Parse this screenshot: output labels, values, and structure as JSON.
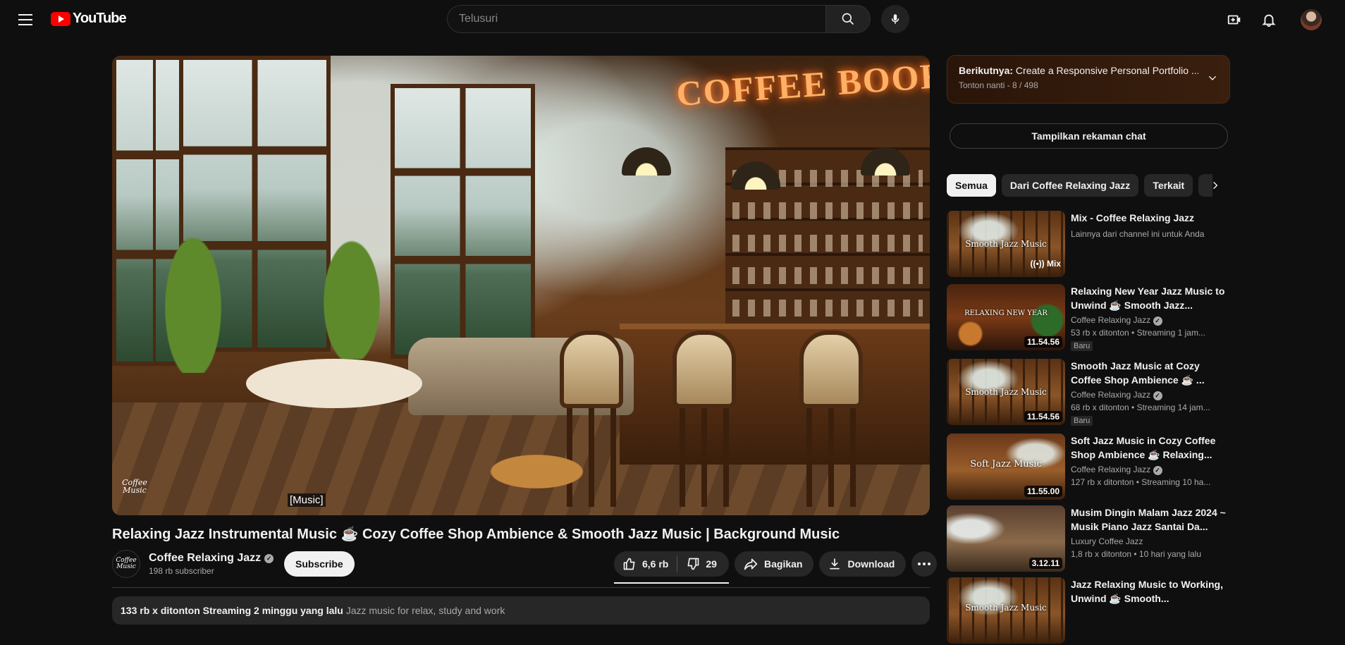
{
  "header": {
    "logo_text": "YouTube",
    "search_placeholder": "Telusuri"
  },
  "video": {
    "caption": "[Music]",
    "watermark": "Coffee Music",
    "scene_sign": "COFFEE BOOK SHOP",
    "title": "Relaxing Jazz Instrumental Music ☕ Cozy Coffee Shop Ambience & Smooth Jazz Music | Background Music"
  },
  "owner": {
    "name": "Coffee Relaxing Jazz",
    "subscribers": "198 rb subscriber",
    "avatar_text": "Coffee Music",
    "subscribe_label": "Subscribe"
  },
  "actions": {
    "likes": "6,6 rb",
    "dislikes": "29",
    "share_label": "Bagikan",
    "download_label": "Download"
  },
  "description": {
    "stats": "133 rb x ditonton  Streaming 2 minggu yang lalu",
    "snippet": "Jazz music for relax, study and work"
  },
  "playlist": {
    "next_prefix": "Berikutnya:",
    "next_title": "Create a Responsive Personal Portfolio ...",
    "position": "Tonton nanti - 8 / 498"
  },
  "chat_button_label": "Tampilkan rekaman chat",
  "chips": [
    "Semua",
    "Dari Coffee Relaxing Jazz",
    "Terkait"
  ],
  "recommendations": [
    {
      "title": "Mix - Coffee Relaxing Jazz",
      "channel": "Lainnya dari channel ini untuk Anda",
      "stats": "",
      "badge": "",
      "thumb_text": "Smooth Jazz Music",
      "duration": "",
      "mix_label": "Mix"
    },
    {
      "title": "Relaxing New Year Jazz Music to Unwind ☕ Smooth Jazz...",
      "channel": "Coffee Relaxing Jazz",
      "stats": "53 rb x ditonton  • Streaming 1 jam...",
      "badge": "Baru",
      "thumb_text": "RELAXING NEW YEAR",
      "duration": "11.54.56",
      "mix_label": ""
    },
    {
      "title": "Smooth Jazz Music at Cozy Coffee Shop Ambience ☕ ...",
      "channel": "Coffee Relaxing Jazz",
      "stats": "68 rb x ditonton  • Streaming 14 jam...",
      "badge": "Baru",
      "thumb_text": "Smooth Jazz Music",
      "duration": "11.54.56",
      "mix_label": ""
    },
    {
      "title": "Soft Jazz Music in Cozy Coffee Shop Ambience ☕ Relaxing...",
      "channel": "Coffee Relaxing Jazz",
      "stats": "127 rb x ditonton  • Streaming 10 ha...",
      "badge": "",
      "thumb_text": "Soft Jazz Music",
      "duration": "11.55.00",
      "mix_label": ""
    },
    {
      "title": "Musim Dingin Malam Jazz 2024 ~ Musik Piano Jazz Santai Da...",
      "channel": "Luxury Coffee Jazz",
      "stats": "1,8 rb x ditonton  • 10 hari yang lalu",
      "badge": "",
      "thumb_text": "",
      "duration": "3.12.11",
      "mix_label": ""
    },
    {
      "title": "Jazz Relaxing Music to Working, Unwind ☕ Smooth...",
      "channel": "",
      "stats": "",
      "badge": "",
      "thumb_text": "Smooth Jazz Music",
      "duration": "",
      "mix_label": ""
    }
  ],
  "colors": {
    "accent_red": "#ff0000",
    "background": "#0f0f0f",
    "chip_bg": "#272727"
  }
}
